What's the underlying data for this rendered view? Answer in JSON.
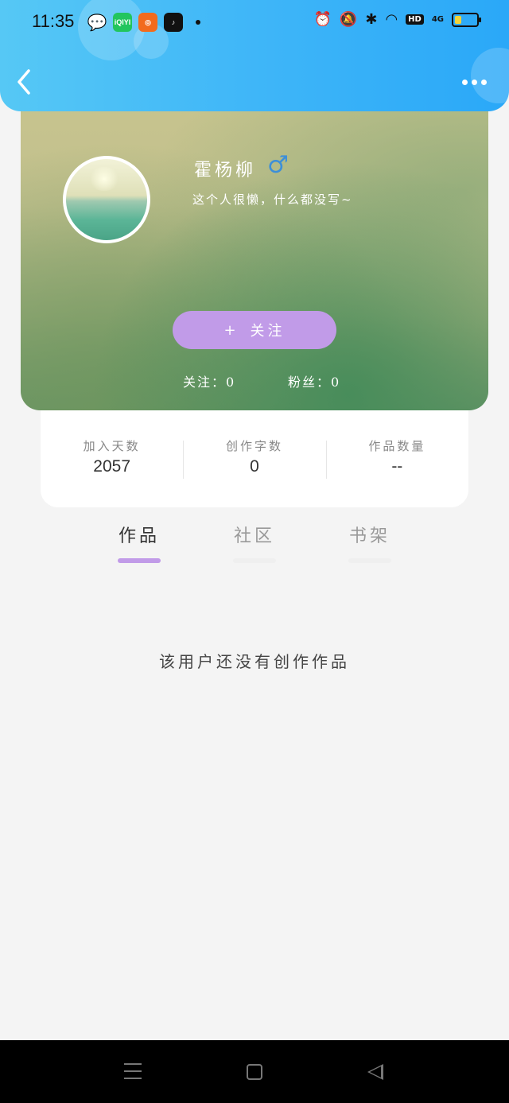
{
  "status_bar": {
    "time": "11:35",
    "apps": [
      {
        "icon": "wechat-icon",
        "label": "",
        "color": "#111111"
      },
      {
        "icon": "iqiyi-icon",
        "label": "iQIYI",
        "color": "#22c55e"
      },
      {
        "icon": "app-icon",
        "label": "",
        "color": "#f26b1d"
      },
      {
        "icon": "tiktok-icon",
        "label": "",
        "color": "#111111"
      }
    ],
    "hd_label": "HD",
    "network_label": "4G",
    "battery_level": 0.3
  },
  "header": {
    "back_icon": "chevron-left-icon",
    "more_icon": "more-horizontal-icon",
    "color": "#3fb6f8"
  },
  "profile": {
    "name": "霍杨柳",
    "gender_symbol": "♂",
    "bio": "这个人很懒，什么都没写~",
    "follow_button": {
      "icon": "+",
      "label": "关注"
    },
    "following_label": "关注：0",
    "followers_label": "粉丝：0",
    "accent_color": "#c19be8"
  },
  "stats": [
    {
      "label": "加入天数",
      "value": "2057"
    },
    {
      "label": "创作字数",
      "value": "0"
    },
    {
      "label": "作品数量",
      "value": "--"
    }
  ],
  "tabs": [
    {
      "label": "作品",
      "active": true
    },
    {
      "label": "社区",
      "active": false
    },
    {
      "label": "书架",
      "active": false
    }
  ],
  "empty_message": "该用户还没有创作作品"
}
